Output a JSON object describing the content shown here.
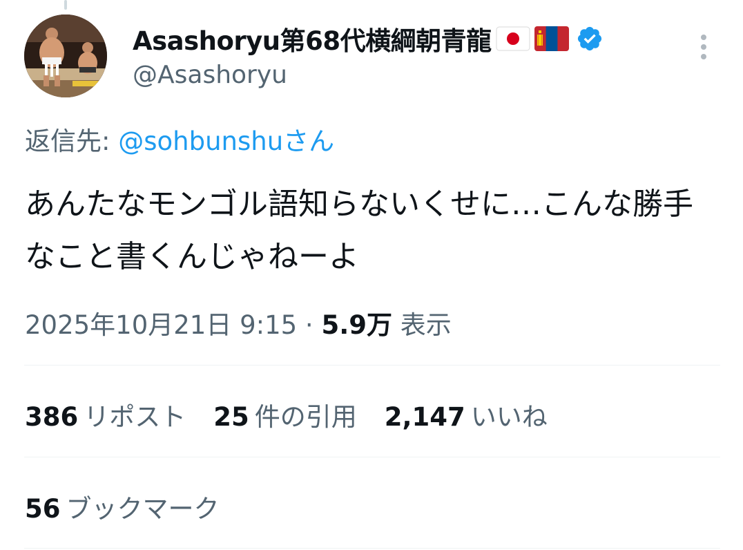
{
  "author": {
    "display_name": "Asashoryu第68代横綱朝青龍",
    "handle": "@Asashoryu",
    "flags": [
      "japan-flag",
      "mongolia-flag"
    ],
    "verified": true
  },
  "reply": {
    "prefix": "返信先: ",
    "target": "@sohbunshuさん"
  },
  "tweet": {
    "text": "あんたなモンゴル語知らないくせに…こんな勝手なこと書くんじゃねーよ"
  },
  "meta": {
    "datetime": "2025年10月21日 9:15 · ",
    "views_count": "5.9万",
    "views_label": " 表示"
  },
  "stats": {
    "reposts": {
      "count": "386",
      "label": "リポスト"
    },
    "quotes": {
      "count": "25",
      "label": "件の引用"
    },
    "likes": {
      "count": "2,147",
      "label": "いいね"
    }
  },
  "bookmarks": {
    "count": "56",
    "label": "ブックマーク"
  },
  "colors": {
    "link": "#1d9bf0",
    "secondary_text": "#536471",
    "primary_text": "#0f1419",
    "verified": "#1d9bf0"
  }
}
